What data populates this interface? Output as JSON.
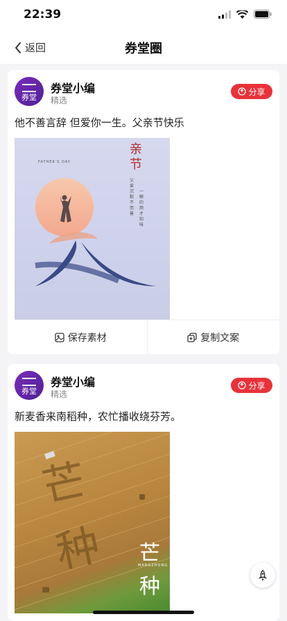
{
  "status": {
    "time": "22:39"
  },
  "nav": {
    "back_label": "返回",
    "title": "券堂圈"
  },
  "posts": [
    {
      "author": "券堂小编",
      "tag": "精选",
      "avatar_text": "券堂",
      "share_label": "分享",
      "text": "他不善言辞 但爱你一生。父亲节快乐",
      "image": {
        "title": "亲节",
        "english": "FATHER'S DAY",
        "big_char": "父",
        "poem_a": "父爱沉默不而善",
        "poem_b": "一瞬的颜才知味"
      },
      "actions": {
        "save": "保存素材",
        "copy": "复制文案"
      }
    },
    {
      "author": "券堂小编",
      "tag": "精选",
      "avatar_text": "券堂",
      "share_label": "分享",
      "text": "新麦香来南稻种，农忙播收绕芬芳。",
      "image": {
        "field_text": "芒种",
        "title_a": "芒",
        "title_b": "种",
        "english": "MANGZHONG"
      }
    }
  ],
  "colors": {
    "accent": "#e8323a",
    "avatar": "#6a27ad"
  }
}
